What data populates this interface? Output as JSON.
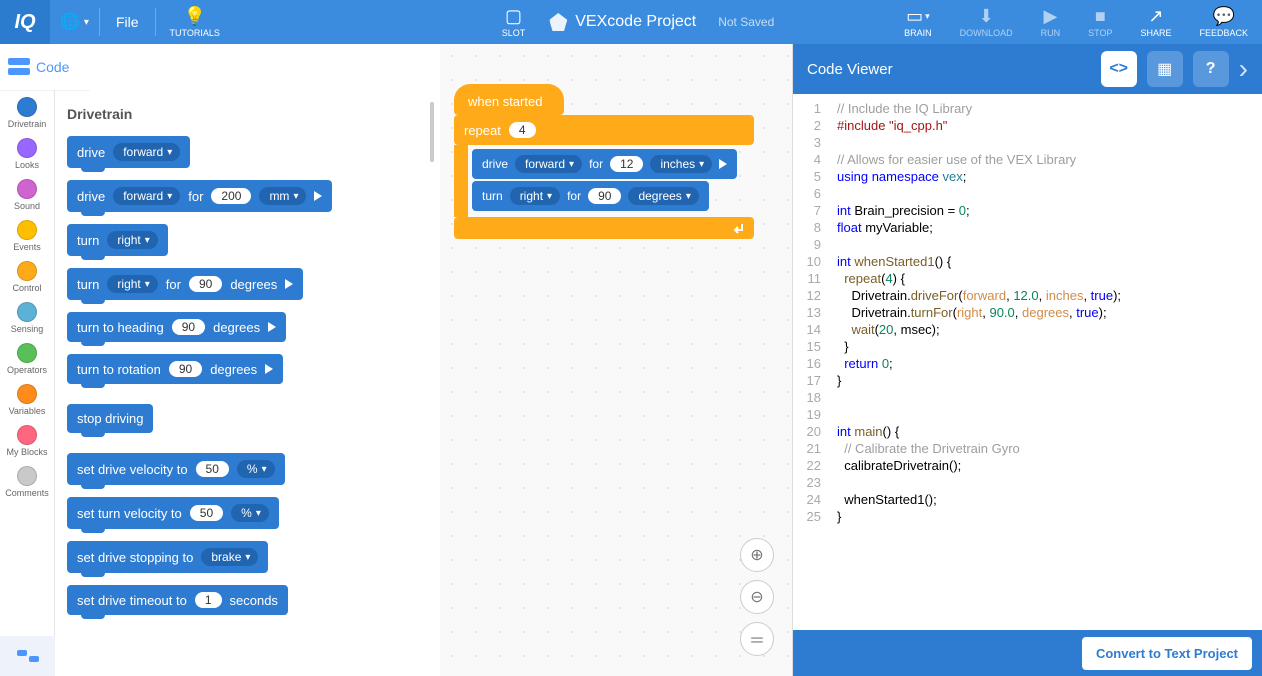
{
  "topbar": {
    "logo": "IQ",
    "file": "File",
    "tutorials": "TUTORIALS",
    "slot": "SLOT",
    "project_name": "VEXcode Project",
    "not_saved": "Not Saved",
    "brain": "BRAIN",
    "download": "DOWNLOAD",
    "run": "RUN",
    "stop": "STOP",
    "share": "SHARE",
    "feedback": "FEEDBACK"
  },
  "code_tab": "Code",
  "categories": [
    {
      "label": "Drivetrain",
      "color": "#2E7CD1"
    },
    {
      "label": "Looks",
      "color": "#9966FF"
    },
    {
      "label": "Sound",
      "color": "#CF63CF"
    },
    {
      "label": "Events",
      "color": "#FFBF00"
    },
    {
      "label": "Control",
      "color": "#FFAB19"
    },
    {
      "label": "Sensing",
      "color": "#5CB1D6"
    },
    {
      "label": "Operators",
      "color": "#59C059"
    },
    {
      "label": "Variables",
      "color": "#FF8C1A"
    },
    {
      "label": "My Blocks",
      "color": "#FF6680"
    },
    {
      "label": "Comments",
      "color": "#C9C9C9"
    }
  ],
  "palette": {
    "title": "Drivetrain",
    "blocks": {
      "drive": "drive",
      "forward": "forward",
      "for": "for",
      "mm": "mm",
      "turn": "turn",
      "right": "right",
      "degrees": "degrees",
      "turn_heading": "turn to heading",
      "turn_rotation": "turn to rotation",
      "stop_driving": "stop driving",
      "set_drive_vel": "set drive velocity to",
      "set_turn_vel": "set turn velocity to",
      "pct": "%",
      "set_stop": "set drive stopping to",
      "brake": "brake",
      "set_timeout": "set drive timeout to",
      "seconds": "seconds",
      "v200": "200",
      "v90": "90",
      "v50": "50",
      "v1": "1"
    }
  },
  "canvas": {
    "when_started": "when started",
    "repeat": "repeat",
    "repeat_n": "4",
    "drive": "drive",
    "forward": "forward",
    "for": "for",
    "n12": "12",
    "inches": "inches",
    "turn": "turn",
    "right": "right",
    "n90": "90",
    "degrees": "degrees"
  },
  "viewer": {
    "title": "Code Viewer",
    "convert": "Convert to Text Project"
  },
  "code": {
    "lines": [
      "1",
      "2",
      "3",
      "4",
      "5",
      "6",
      "7",
      "8",
      "9",
      "10",
      "11",
      "12",
      "13",
      "14",
      "15",
      "16",
      "17",
      "18",
      "19",
      "20",
      "21",
      "22",
      "23",
      "24",
      "25"
    ],
    "l1": "// Include the IQ Library",
    "l2a": "#include ",
    "l2b": "\"iq_cpp.h\"",
    "l4": "// Allows for easier use of the VEX Library",
    "l5a": "using",
    "l5b": "namespace",
    "l5c": "vex",
    "semi": ";",
    "l7a": "int",
    "l7b": "Brain_precision = ",
    "l7c": "0",
    "l8a": "float",
    "l8b": "myVariable;",
    "l10a": "int",
    "l10b": "whenStarted1",
    "l10c": "() {",
    "l11a": "  repeat",
    "l11b": "(",
    "l11c": "4",
    "l11d": ") {",
    "l12a": "    Drivetrain.",
    "l12b": "driveFor",
    "l12c": "(",
    "l12d": "forward",
    "l12e": ", ",
    "l12f": "12.0",
    "l12g": ", ",
    "l12h": "inches",
    "l12i": ", ",
    "l12j": "true",
    "l12k": ");",
    "l13a": "    Drivetrain.",
    "l13b": "turnFor",
    "l13c": "(",
    "l13d": "right",
    "l13e": ", ",
    "l13f": "90.0",
    "l13g": ", ",
    "l13h": "degrees",
    "l13i": ", ",
    "l13j": "true",
    "l13k": ");",
    "l14a": "    wait",
    "l14b": "(",
    "l14c": "20",
    "l14d": ", msec);",
    "l15": "  }",
    "l16a": "  return",
    "l16b": " ",
    "l16c": "0",
    "l16d": ";",
    "l17": "}",
    "l20a": "int",
    "l20b": "main",
    "l20c": "() {",
    "l21": "  // Calibrate the Drivetrain Gyro",
    "l22": "  calibrateDrivetrain();",
    "l24": "  whenStarted1();",
    "l25": "}"
  }
}
